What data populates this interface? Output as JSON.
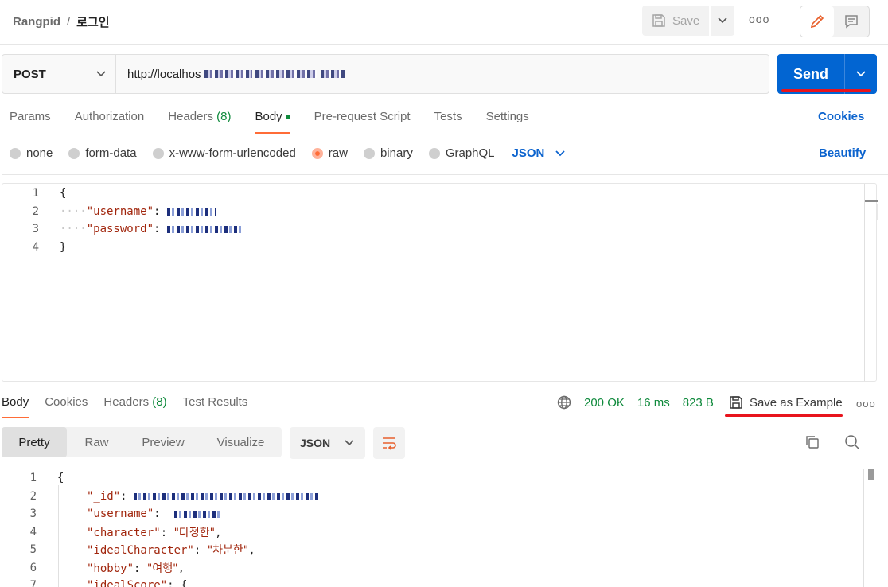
{
  "breadcrumb": {
    "collection": "Rangpid",
    "separator": "/",
    "request": "로그인"
  },
  "header": {
    "save_label": "Save",
    "more": "ooo"
  },
  "request": {
    "method": "POST",
    "url": "http://localhos",
    "send_label": "Send"
  },
  "request_tabs": [
    {
      "label": "Params"
    },
    {
      "label": "Authorization"
    },
    {
      "label": "Headers",
      "count": "(8)"
    },
    {
      "label": "Body"
    },
    {
      "label": "Pre-request Script"
    },
    {
      "label": "Tests"
    },
    {
      "label": "Settings"
    }
  ],
  "cookies_label": "Cookies",
  "body_types": [
    "none",
    "form-data",
    "x-www-form-urlencoded",
    "raw",
    "binary",
    "GraphQL"
  ],
  "body_format": "JSON",
  "beautify_label": "Beautify",
  "request_body": {
    "line_numbers": [
      "1",
      "2",
      "3",
      "4"
    ],
    "open": "{",
    "username_key": "\"username\"",
    "password_key": "\"password\"",
    "colon": ":",
    "close": "}"
  },
  "response_tabs": [
    {
      "label": "Body"
    },
    {
      "label": "Cookies"
    },
    {
      "label": "Headers",
      "count": "(8)"
    },
    {
      "label": "Test Results"
    }
  ],
  "response_meta": {
    "status": "200 OK",
    "time": "16 ms",
    "size": "823 B",
    "save_example": "Save as Example"
  },
  "response_formats": [
    "Pretty",
    "Raw",
    "Preview",
    "Visualize"
  ],
  "response_format": "JSON",
  "response_body": {
    "line_numbers": [
      "1",
      "2",
      "3",
      "4",
      "5",
      "6",
      "7"
    ],
    "open": "{",
    "id_key": "\"_id\"",
    "username_key": "\"username\"",
    "character_key": "\"character\"",
    "character_val": "\"다정한\"",
    "ideal_key": "\"idealCharacter\"",
    "ideal_val": "\"차분한\"",
    "hobby_key": "\"hobby\"",
    "hobby_val": "\"여행\"",
    "score_key": "\"idealScore\"",
    "score_open": "{"
  },
  "colors": {
    "accent": "#ff6c37",
    "send": "#0265d2",
    "link": "#0b63ce",
    "ok": "#0f8a3c",
    "highlight": "#e8141d"
  }
}
